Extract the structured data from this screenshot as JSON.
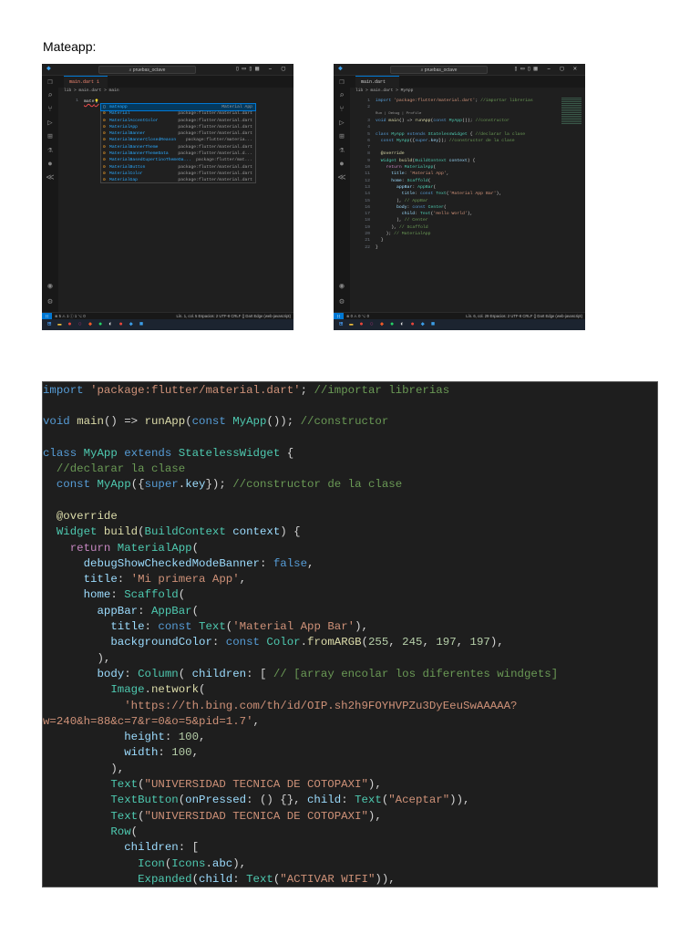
{
  "heading": "Mateapp:",
  "screens": [
    {
      "search": "pruebas_octave",
      "tab": "main.dart 1",
      "breadcrumb": "lib > main.dart > main",
      "lines": [
        {
          "n": "1",
          "tokens": [
            [
              "mate",
              "d"
            ]
          ]
        }
      ],
      "suggestions": [
        {
          "label": "mateapp",
          "pkg": "Material App"
        },
        {
          "label": "Material",
          "pkg": "package:flutter/material.dart"
        },
        {
          "label": "MaterialAccentColor",
          "pkg": "package:flutter/material.dart"
        },
        {
          "label": "MaterialApp",
          "pkg": "package:flutter/material.dart"
        },
        {
          "label": "MaterialBanner",
          "pkg": "package:flutter/material.dart"
        },
        {
          "label": "MaterialBannerClosedReason",
          "pkg": "package:flutter/materia..."
        },
        {
          "label": "MaterialBannerTheme",
          "pkg": "package:flutter/material.dart"
        },
        {
          "label": "MaterialBannerThemeData",
          "pkg": "package:flutter/material.d..."
        },
        {
          "label": "MaterialBasedCupertinoThemeDa...",
          "pkg": "package:flutter/mat..."
        },
        {
          "label": "MaterialButton",
          "pkg": "package:flutter/material.dart"
        },
        {
          "label": "MaterialColor",
          "pkg": "package:flutter/material.dart"
        },
        {
          "label": "MaterialGap",
          "pkg": "package:flutter/material.dart"
        }
      ],
      "status_left": "⊗ 5 ⚠ 1 ⓘ 1   ⌥ 0",
      "status_right": "Lín. 1, col. 5   Espacios: 2   UTF-8   CRLF   {} Dart   Edge (web-javascript)"
    },
    {
      "search": "pruebas_octave",
      "tab": "main.dart",
      "breadcrumb": "lib > main.dart > MyApp",
      "codelens": "Run | Debug | Profile",
      "lines": [
        {
          "n": "1",
          "tokens": [
            [
              "import ",
              "k"
            ],
            [
              "'package:flutter/material.dart'",
              "s"
            ],
            [
              "; ",
              "d"
            ],
            [
              "//importar librerias",
              "c"
            ]
          ]
        },
        {
          "n": "2",
          "tokens": []
        },
        {
          "n": "3",
          "tokens": [
            [
              "void ",
              "k"
            ],
            [
              "main",
              "f"
            ],
            [
              "() => ",
              "d"
            ],
            [
              "runApp",
              "f"
            ],
            [
              "(",
              "d"
            ],
            [
              "const ",
              "k"
            ],
            [
              "MyApp",
              "t"
            ],
            [
              "()); ",
              "d"
            ],
            [
              "//constructor",
              "c"
            ]
          ]
        },
        {
          "n": "4",
          "tokens": []
        },
        {
          "n": "5",
          "tokens": [
            [
              "class ",
              "k"
            ],
            [
              "MyApp ",
              "t"
            ],
            [
              "extends ",
              "k"
            ],
            [
              "StatelessWidget ",
              "t"
            ],
            [
              "{ ",
              "d"
            ],
            [
              "//declarar la clase",
              "c"
            ]
          ]
        },
        {
          "n": "6",
          "tokens": [
            [
              "  const ",
              "k"
            ],
            [
              "MyApp",
              "t"
            ],
            [
              "({",
              "d"
            ],
            [
              "super",
              "k"
            ],
            [
              ".",
              "d"
            ],
            [
              "key",
              "p"
            ],
            [
              "}); ",
              "d"
            ],
            [
              "//constructor de la clase",
              "c"
            ]
          ]
        },
        {
          "n": "7",
          "tokens": []
        },
        {
          "n": "8",
          "tokens": [
            [
              "  @override",
              "f"
            ]
          ]
        },
        {
          "n": "9",
          "tokens": [
            [
              "  Widget ",
              "t"
            ],
            [
              "build",
              "f"
            ],
            [
              "(",
              "d"
            ],
            [
              "BuildContext ",
              "t"
            ],
            [
              "context",
              "p"
            ],
            [
              ") {",
              "d"
            ]
          ]
        },
        {
          "n": "10",
          "tokens": [
            [
              "    return ",
              "r"
            ],
            [
              "MaterialApp",
              "t"
            ],
            [
              "(",
              "d"
            ]
          ]
        },
        {
          "n": "11",
          "tokens": [
            [
              "      title",
              "p"
            ],
            [
              ": ",
              "d"
            ],
            [
              "'Material App'",
              "s"
            ],
            [
              ",",
              "d"
            ]
          ]
        },
        {
          "n": "12",
          "tokens": [
            [
              "      home",
              "p"
            ],
            [
              ": ",
              "d"
            ],
            [
              "Scaffold",
              "t"
            ],
            [
              "(",
              "d"
            ]
          ]
        },
        {
          "n": "13",
          "tokens": [
            [
              "        appBar",
              "p"
            ],
            [
              ": ",
              "d"
            ],
            [
              "AppBar",
              "t"
            ],
            [
              "(",
              "d"
            ]
          ]
        },
        {
          "n": "14",
          "tokens": [
            [
              "          title",
              "p"
            ],
            [
              ": ",
              "d"
            ],
            [
              "const ",
              "k"
            ],
            [
              "Text",
              "t"
            ],
            [
              "(",
              "d"
            ],
            [
              "'Material App Bar'",
              "s"
            ],
            [
              "),",
              "d"
            ]
          ]
        },
        {
          "n": "15",
          "tokens": [
            [
              "        ), ",
              "d"
            ],
            [
              "// AppBar",
              "c"
            ]
          ]
        },
        {
          "n": "16",
          "tokens": [
            [
              "        body",
              "p"
            ],
            [
              ": ",
              "d"
            ],
            [
              "const ",
              "k"
            ],
            [
              "Center",
              "t"
            ],
            [
              "(",
              "d"
            ]
          ]
        },
        {
          "n": "17",
          "tokens": [
            [
              "          child",
              "p"
            ],
            [
              ": ",
              "d"
            ],
            [
              "Text",
              "t"
            ],
            [
              "(",
              "d"
            ],
            [
              "'Hello World'",
              "s"
            ],
            [
              "),",
              "d"
            ]
          ]
        },
        {
          "n": "18",
          "tokens": [
            [
              "        ), ",
              "d"
            ],
            [
              "// Center",
              "c"
            ]
          ]
        },
        {
          "n": "19",
          "tokens": [
            [
              "      ), ",
              "d"
            ],
            [
              "// Scaffold",
              "c"
            ]
          ]
        },
        {
          "n": "20",
          "tokens": [
            [
              "    ); ",
              "d"
            ],
            [
              "// MaterialApp",
              "c"
            ]
          ]
        },
        {
          "n": "21",
          "tokens": [
            [
              "  }",
              "d"
            ]
          ]
        },
        {
          "n": "22",
          "tokens": [
            [
              "}",
              "d"
            ]
          ]
        }
      ],
      "status_left": "⊗ 0 ⚠ 0   ⌥ 0",
      "status_right": "Lín. 6, col. 29   Espacios: 2   UTF-8   CRLF   {} Dart   Edge (web-javascript)"
    }
  ],
  "code": [
    [
      [
        "import ",
        "k"
      ],
      [
        "'package:flutter/material.dart'",
        "s"
      ],
      [
        "; ",
        "d"
      ],
      [
        "//importar librerias",
        "c"
      ]
    ],
    [],
    [
      [
        "void ",
        "k"
      ],
      [
        "main",
        "f"
      ],
      [
        "() => ",
        "d"
      ],
      [
        "runApp",
        "f"
      ],
      [
        "(",
        "d"
      ],
      [
        "const ",
        "k"
      ],
      [
        "MyApp",
        "t"
      ],
      [
        "()); ",
        "d"
      ],
      [
        "//constructor",
        "c"
      ]
    ],
    [],
    [
      [
        "class ",
        "k"
      ],
      [
        "MyApp ",
        "t"
      ],
      [
        "extends ",
        "k"
      ],
      [
        "StatelessWidget ",
        "t"
      ],
      [
        "{",
        "d"
      ]
    ],
    [
      [
        "  //declarar la clase",
        "c"
      ]
    ],
    [
      [
        "  const ",
        "k"
      ],
      [
        "MyApp",
        "t"
      ],
      [
        "({",
        "d"
      ],
      [
        "super",
        "k"
      ],
      [
        ".",
        "d"
      ],
      [
        "key",
        "p"
      ],
      [
        "}); ",
        "d"
      ],
      [
        "//constructor de la clase",
        "c"
      ]
    ],
    [],
    [
      [
        "  @override",
        "f"
      ]
    ],
    [
      [
        "  Widget ",
        "t"
      ],
      [
        "build",
        "f"
      ],
      [
        "(",
        "d"
      ],
      [
        "BuildContext ",
        "t"
      ],
      [
        "context",
        "p"
      ],
      [
        ") {",
        "d"
      ]
    ],
    [
      [
        "    return ",
        "r"
      ],
      [
        "MaterialApp",
        "t"
      ],
      [
        "(",
        "d"
      ]
    ],
    [
      [
        "      debugShowCheckedModeBanner",
        "p"
      ],
      [
        ": ",
        "d"
      ],
      [
        "false",
        "k"
      ],
      [
        ",",
        "d"
      ]
    ],
    [
      [
        "      title",
        "p"
      ],
      [
        ": ",
        "d"
      ],
      [
        "'Mi primera App'",
        "s"
      ],
      [
        ",",
        "d"
      ]
    ],
    [
      [
        "      home",
        "p"
      ],
      [
        ": ",
        "d"
      ],
      [
        "Scaffold",
        "t"
      ],
      [
        "(",
        "d"
      ]
    ],
    [
      [
        "        appBar",
        "p"
      ],
      [
        ": ",
        "d"
      ],
      [
        "AppBar",
        "t"
      ],
      [
        "(",
        "d"
      ]
    ],
    [
      [
        "          title",
        "p"
      ],
      [
        ": ",
        "d"
      ],
      [
        "const ",
        "k"
      ],
      [
        "Text",
        "t"
      ],
      [
        "(",
        "d"
      ],
      [
        "'Material App Bar'",
        "s"
      ],
      [
        "),",
        "d"
      ]
    ],
    [
      [
        "          backgroundColor",
        "p"
      ],
      [
        ": ",
        "d"
      ],
      [
        "const ",
        "k"
      ],
      [
        "Color",
        "t"
      ],
      [
        ".",
        "d"
      ],
      [
        "fromARGB",
        "f"
      ],
      [
        "(",
        "d"
      ],
      [
        "255",
        "n"
      ],
      [
        ", ",
        "d"
      ],
      [
        "245",
        "n"
      ],
      [
        ", ",
        "d"
      ],
      [
        "197",
        "n"
      ],
      [
        ", ",
        "d"
      ],
      [
        "197",
        "n"
      ],
      [
        "),",
        "d"
      ]
    ],
    [
      [
        "        ),",
        "d"
      ]
    ],
    [
      [
        "        body",
        "p"
      ],
      [
        ": ",
        "d"
      ],
      [
        "Column",
        "t"
      ],
      [
        "( ",
        "d"
      ],
      [
        "children",
        "p"
      ],
      [
        ": [ ",
        "d"
      ],
      [
        "// [array encolar los diferentes windgets]",
        "c"
      ]
    ],
    [
      [
        "          Image",
        "t"
      ],
      [
        ".",
        "d"
      ],
      [
        "network",
        "f"
      ],
      [
        "(",
        "d"
      ]
    ],
    [
      [
        "            'https://th.bing.com/th/id/OIP.sh2h9FOYHVPZu3DyEeuSwAAAAA?",
        "s"
      ]
    ],
    [
      [
        "w=240&h=88&c=7&r=0&o=5&pid=1.7'",
        "s"
      ],
      [
        ",",
        "d"
      ]
    ],
    [
      [
        "            height",
        "p"
      ],
      [
        ": ",
        "d"
      ],
      [
        "100",
        "n"
      ],
      [
        ",",
        "d"
      ]
    ],
    [
      [
        "            width",
        "p"
      ],
      [
        ": ",
        "d"
      ],
      [
        "100",
        "n"
      ],
      [
        ",",
        "d"
      ]
    ],
    [
      [
        "          ),",
        "d"
      ]
    ],
    [
      [
        "          Text",
        "t"
      ],
      [
        "(",
        "d"
      ],
      [
        "\"UNIVERSIDAD TECNICA DE COTOPAXI\"",
        "s"
      ],
      [
        "),",
        "d"
      ]
    ],
    [
      [
        "          TextButton",
        "t"
      ],
      [
        "(",
        "d"
      ],
      [
        "onPressed",
        "p"
      ],
      [
        ": () {}, ",
        "d"
      ],
      [
        "child",
        "p"
      ],
      [
        ": ",
        "d"
      ],
      [
        "Text",
        "t"
      ],
      [
        "(",
        "d"
      ],
      [
        "\"Aceptar\"",
        "s"
      ],
      [
        ")),",
        "d"
      ]
    ],
    [
      [
        "          Text",
        "t"
      ],
      [
        "(",
        "d"
      ],
      [
        "\"UNIVERSIDAD TECNICA DE COTOPAXI\"",
        "s"
      ],
      [
        "),",
        "d"
      ]
    ],
    [
      [
        "          Row",
        "t"
      ],
      [
        "(",
        "d"
      ]
    ],
    [
      [
        "            children",
        "p"
      ],
      [
        ": [",
        "d"
      ]
    ],
    [
      [
        "              Icon",
        "t"
      ],
      [
        "(",
        "d"
      ],
      [
        "Icons",
        "t"
      ],
      [
        ".",
        "d"
      ],
      [
        "abc",
        "p"
      ],
      [
        "),",
        "d"
      ]
    ],
    [
      [
        "              Expanded",
        "t"
      ],
      [
        "(",
        "d"
      ],
      [
        "child",
        "p"
      ],
      [
        ": ",
        "d"
      ],
      [
        "Text",
        "t"
      ],
      [
        "(",
        "d"
      ],
      [
        "\"ACTIVAR WIFI\"",
        "s"
      ],
      [
        ")),",
        "d"
      ]
    ]
  ]
}
